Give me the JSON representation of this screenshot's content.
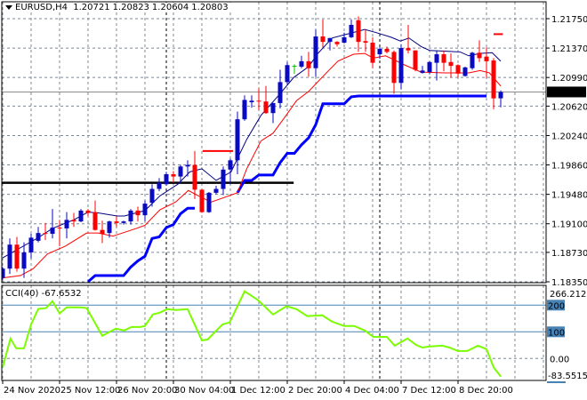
{
  "header": {
    "symbol": "EURUSD,H4",
    "open": "1.20721",
    "high": "1.20823",
    "low": "1.20604",
    "close": "1.20803"
  },
  "colors": {
    "bull": "#0a0ac0",
    "bear": "#ff0000",
    "doji": "#00c000",
    "fast_line": "#000080",
    "slow_line": "#ff0000",
    "stop_line": "#0000ff",
    "cci_line": "#7cfc00",
    "cci_levels": "#4682b4",
    "grid": "#7f8896"
  },
  "chart_data": {
    "type": "candlestick",
    "title": "EURUSD,H4",
    "ylim": [
      1.1835,
      1.2175
    ],
    "price_ticks": [
      "1.21750",
      "1.21370",
      "1.20990",
      "1.20620",
      "1.20240",
      "1.19860",
      "1.19480",
      "1.19100",
      "1.18730",
      "1.18350"
    ],
    "current_price": "1.20803",
    "time_labels": [
      {
        "bar": 1,
        "label": "24 Nov 2020"
      },
      {
        "bar": 9,
        "label": "25 Nov 12:00"
      },
      {
        "bar": 17,
        "label": "26 Nov 20:00"
      },
      {
        "bar": 25,
        "label": "30 Nov 04:00"
      },
      {
        "bar": 33,
        "label": "1 Dec 12:00"
      },
      {
        "bar": 41,
        "label": "2 Dec 20:00"
      },
      {
        "bar": 49,
        "label": "4 Dec 04:00"
      },
      {
        "bar": 57,
        "label": "7 Dec 12:00"
      },
      {
        "bar": 65,
        "label": "8 Dec 20:00"
      }
    ],
    "period_separators": [
      24,
      54
    ],
    "ohlc": [
      [
        1.184,
        1.1854,
        1.1838,
        1.1852
      ],
      [
        1.1852,
        1.1891,
        1.1845,
        1.1883
      ],
      [
        1.1883,
        1.1893,
        1.1848,
        1.1852
      ],
      [
        1.1852,
        1.1886,
        1.184,
        1.1873
      ],
      [
        1.1873,
        1.1897,
        1.1865,
        1.1892
      ],
      [
        1.1888,
        1.1906,
        1.1886,
        1.1898
      ],
      [
        1.1898,
        1.1911,
        1.1889,
        1.1897
      ],
      [
        1.1897,
        1.1929,
        1.1891,
        1.1905
      ],
      [
        1.1905,
        1.1915,
        1.1881,
        1.1904
      ],
      [
        1.1904,
        1.1925,
        1.1891,
        1.1915
      ],
      [
        1.1915,
        1.1924,
        1.1906,
        1.1913
      ],
      [
        1.1913,
        1.1929,
        1.1912,
        1.1927
      ],
      [
        1.1927,
        1.1929,
        1.192,
        1.1924
      ],
      [
        1.1925,
        1.194,
        1.1901,
        1.1902
      ],
      [
        1.1902,
        1.1914,
        1.1885,
        1.1897
      ],
      [
        1.1898,
        1.1914,
        1.1892,
        1.1913
      ],
      [
        1.1913,
        1.192,
        1.1906,
        1.1911
      ],
      [
        1.1911,
        1.1914,
        1.1909,
        1.1913
      ],
      [
        1.1913,
        1.1929,
        1.1909,
        1.1927
      ],
      [
        1.1927,
        1.1932,
        1.1913,
        1.1921
      ],
      [
        1.1921,
        1.194,
        1.1913,
        1.1936
      ],
      [
        1.1937,
        1.1961,
        1.1932,
        1.1955
      ],
      [
        1.1955,
        1.1969,
        1.1952,
        1.1963
      ],
      [
        1.1961,
        1.1977,
        1.196,
        1.1974
      ],
      [
        1.1974,
        1.1978,
        1.1963,
        1.1971
      ],
      [
        1.1971,
        1.1986,
        1.1962,
        1.1984
      ],
      [
        1.1984,
        1.1992,
        1.1971,
        1.1986
      ],
      [
        1.1986,
        1.2004,
        1.1942,
        1.1954
      ],
      [
        1.1954,
        1.1955,
        1.1924,
        1.1925
      ],
      [
        1.1925,
        1.1951,
        1.1924,
        1.195
      ],
      [
        1.195,
        1.1959,
        1.1948,
        1.1955
      ],
      [
        1.1955,
        1.1984,
        1.1947,
        1.198
      ],
      [
        1.198,
        1.1994,
        1.1961,
        1.1992
      ],
      [
        1.1992,
        1.2055,
        1.1974,
        1.2045
      ],
      [
        1.2045,
        1.2076,
        1.2043,
        1.207
      ],
      [
        1.2067,
        1.2076,
        1.206,
        1.2069
      ],
      [
        1.2069,
        1.2085,
        1.2057,
        1.2068
      ],
      [
        1.2068,
        1.2088,
        1.2052,
        1.2053
      ],
      [
        1.2053,
        1.2066,
        1.204,
        1.2066
      ],
      [
        1.2066,
        1.2109,
        1.2059,
        1.2093
      ],
      [
        1.2093,
        1.2119,
        1.209,
        1.2115
      ],
      [
        1.2114,
        1.2116,
        1.2104,
        1.2114
      ],
      [
        1.2113,
        1.2127,
        1.2111,
        1.212
      ],
      [
        1.212,
        1.2132,
        1.21,
        1.2111
      ],
      [
        1.2111,
        1.2161,
        1.21,
        1.2152
      ],
      [
        1.2152,
        1.2174,
        1.2138,
        1.2145
      ],
      [
        1.2145,
        1.215,
        1.2134,
        1.215
      ],
      [
        1.2145,
        1.2146,
        1.2139,
        1.2142
      ],
      [
        1.2144,
        1.2157,
        1.2143,
        1.2151
      ],
      [
        1.2151,
        1.2174,
        1.215,
        1.2167
      ],
      [
        1.2173,
        1.2178,
        1.2132,
        1.2145
      ],
      [
        1.2146,
        1.2161,
        1.2132,
        1.2144
      ],
      [
        1.2144,
        1.2151,
        1.2111,
        1.2118
      ],
      [
        1.2129,
        1.2138,
        1.2123,
        1.2136
      ],
      [
        1.2136,
        1.2139,
        1.213,
        1.2132
      ],
      [
        1.2132,
        1.2134,
        1.2078,
        1.2092
      ],
      [
        1.2092,
        1.2142,
        1.2084,
        1.2137
      ],
      [
        1.2137,
        1.2167,
        1.213,
        1.2134
      ],
      [
        1.2134,
        1.2134,
        1.2107,
        1.2109
      ],
      [
        1.2105,
        1.2114,
        1.2104,
        1.2108
      ],
      [
        1.2106,
        1.212,
        1.2103,
        1.2119
      ],
      [
        1.2118,
        1.2134,
        1.2095,
        1.2129
      ],
      [
        1.2129,
        1.2134,
        1.2107,
        1.2118
      ],
      [
        1.2119,
        1.213,
        1.2099,
        1.2114
      ],
      [
        1.2115,
        1.2116,
        1.2099,
        1.2104
      ],
      [
        1.2101,
        1.2113,
        1.21,
        1.2112
      ],
      [
        1.2111,
        1.2132,
        1.2109,
        1.2131
      ],
      [
        1.2131,
        1.2147,
        1.2119,
        1.2124
      ],
      [
        1.2126,
        1.2138,
        1.2098,
        1.212
      ],
      [
        1.2121,
        1.2124,
        1.2058,
        1.2072
      ],
      [
        1.20721,
        1.20823,
        1.20604,
        1.20803
      ]
    ],
    "fast_line": [
      [
        1,
        1.1866
      ],
      [
        6,
        1.1892
      ],
      [
        8,
        1.1904
      ],
      [
        11,
        1.1915
      ],
      [
        13,
        1.1925
      ],
      [
        14.4,
        1.1924
      ],
      [
        17.1,
        1.192
      ],
      [
        18.1,
        1.192
      ],
      [
        21,
        1.1927
      ],
      [
        23.1,
        1.1946
      ],
      [
        25.6,
        1.1961
      ],
      [
        27.3,
        1.1977
      ],
      [
        29,
        1.1981
      ],
      [
        31,
        1.1966
      ],
      [
        33.1,
        1.1977
      ],
      [
        35.3,
        1.2019
      ],
      [
        37.3,
        1.205
      ],
      [
        39.8,
        1.2076
      ],
      [
        41.9,
        1.2099
      ],
      [
        44,
        1.2113
      ],
      [
        45.3,
        1.213
      ],
      [
        47.3,
        1.215
      ],
      [
        49.4,
        1.2155
      ],
      [
        51.9,
        1.2161
      ],
      [
        53.5,
        1.2157
      ],
      [
        55.6,
        1.2151
      ],
      [
        56.9,
        1.2146
      ],
      [
        58.1,
        1.215
      ],
      [
        59.8,
        1.2139
      ],
      [
        61,
        1.2134
      ],
      [
        65.3,
        1.2132
      ],
      [
        66.5,
        1.2127
      ],
      [
        68.1,
        1.213
      ],
      [
        69.8,
        1.2131
      ],
      [
        71,
        1.212
      ]
    ],
    "slow_line": [
      [
        1,
        1.184
      ],
      [
        3.5,
        1.1843
      ],
      [
        5.3,
        1.1852
      ],
      [
        7.3,
        1.1871
      ],
      [
        9.8,
        1.1881
      ],
      [
        12.8,
        1.1898
      ],
      [
        14.4,
        1.1898
      ],
      [
        16.5,
        1.1894
      ],
      [
        19.8,
        1.1904
      ],
      [
        21,
        1.1908
      ],
      [
        23.1,
        1.1928
      ],
      [
        25.3,
        1.1938
      ],
      [
        27.1,
        1.1953
      ],
      [
        28.5,
        1.1946
      ],
      [
        30.3,
        1.1938
      ],
      [
        34,
        1.195
      ],
      [
        35.3,
        1.1981
      ],
      [
        37.3,
        1.2017
      ],
      [
        39,
        1.2027
      ],
      [
        40.6,
        1.2047
      ],
      [
        42.3,
        1.2069
      ],
      [
        44,
        1.2081
      ],
      [
        46.5,
        1.2105
      ],
      [
        48.1,
        1.212
      ],
      [
        50.3,
        1.2129
      ],
      [
        51.9,
        1.213
      ],
      [
        53.1,
        1.2124
      ],
      [
        54.8,
        1.2127
      ],
      [
        56,
        1.2122
      ],
      [
        57.3,
        1.2116
      ],
      [
        59.8,
        1.2106
      ],
      [
        63.1,
        1.2105
      ],
      [
        66.5,
        1.2105
      ],
      [
        68.1,
        1.2108
      ],
      [
        69.4,
        1.2105
      ],
      [
        71,
        1.2088
      ]
    ],
    "stop_line_segments": [
      [
        [
          13,
          1.1835
        ],
        [
          14,
          1.1843
        ],
        [
          18,
          1.1843
        ],
        [
          19,
          1.1854
        ],
        [
          20,
          1.1862
        ],
        [
          21,
          1.1868
        ],
        [
          22,
          1.1891
        ],
        [
          23,
          1.1893
        ],
        [
          24,
          1.1905
        ],
        [
          25,
          1.1909
        ],
        [
          26,
          1.1923
        ],
        [
          27,
          1.193
        ],
        [
          28,
          1.193
        ]
      ],
      [
        [
          34,
          1.195
        ],
        [
          35,
          1.1966
        ],
        [
          36,
          1.1966
        ],
        [
          37,
          1.1973
        ],
        [
          39,
          1.1973
        ],
        [
          40,
          1.1989
        ],
        [
          41,
          1.2001
        ],
        [
          42,
          1.2001
        ],
        [
          43,
          1.2012
        ],
        [
          44,
          1.2021
        ],
        [
          45,
          1.2038
        ],
        [
          46,
          1.2065
        ],
        [
          49,
          1.2065
        ],
        [
          50,
          1.2074
        ],
        [
          51,
          1.2075
        ],
        [
          69,
          1.2075
        ]
      ]
    ],
    "horizontal_levels": [
      {
        "price": 1.1963,
        "from_bar": 0.8,
        "to_bar": 41.9,
        "color": "#000000",
        "kind": "support-line"
      },
      {
        "price": 1.2004,
        "from_bar": 29.1,
        "to_bar": 33.4,
        "color": "#ff0000",
        "kind": "resistance-segment"
      },
      {
        "price": 1.2155,
        "from_bar": 70,
        "to_bar": 71.3,
        "color": "#ff0000",
        "kind": "resistance-segment"
      }
    ],
    "cci": {
      "title": "CCI(40) -67.6532",
      "ylim": [
        -83.5515,
        266.212
      ],
      "scale_labels": {
        "max": "266.212",
        "level_200": "200",
        "level_100": "100",
        "zero": "0.00",
        "min": "-83.5515"
      },
      "levels": [
        200,
        100
      ],
      "points": [
        [
          1,
          -33
        ],
        [
          2.1,
          75
        ],
        [
          2.9,
          38
        ],
        [
          4,
          38
        ],
        [
          5,
          128
        ],
        [
          6,
          186
        ],
        [
          7.1,
          189
        ],
        [
          8,
          215
        ],
        [
          9,
          169
        ],
        [
          10,
          192
        ],
        [
          11.9,
          192
        ],
        [
          12.8,
          189
        ],
        [
          15,
          85
        ],
        [
          16.9,
          112
        ],
        [
          18.1,
          105
        ],
        [
          19.1,
          118
        ],
        [
          20.3,
          118
        ],
        [
          21,
          122
        ],
        [
          22.1,
          165
        ],
        [
          23.1,
          172
        ],
        [
          24.1,
          185
        ],
        [
          25.3,
          182
        ],
        [
          27,
          185
        ],
        [
          29,
          68
        ],
        [
          29.8,
          71
        ],
        [
          31.9,
          128
        ],
        [
          32.9,
          135
        ],
        [
          35,
          252
        ],
        [
          36.9,
          219
        ],
        [
          39,
          165
        ],
        [
          40.9,
          196
        ],
        [
          42.3,
          185
        ],
        [
          43.8,
          159
        ],
        [
          45.9,
          162
        ],
        [
          47.3,
          138
        ],
        [
          49,
          122
        ],
        [
          50.4,
          122
        ],
        [
          51.9,
          105
        ],
        [
          53.1,
          81
        ],
        [
          55,
          81
        ],
        [
          56.1,
          48
        ],
        [
          57.9,
          75
        ],
        [
          59.1,
          51
        ],
        [
          60,
          41
        ],
        [
          61,
          45
        ],
        [
          62.8,
          48
        ],
        [
          63.8,
          41
        ],
        [
          65,
          28
        ],
        [
          66.3,
          28
        ],
        [
          67.8,
          48
        ],
        [
          69,
          35
        ],
        [
          70,
          -33
        ],
        [
          71,
          -67.6532
        ]
      ]
    }
  }
}
